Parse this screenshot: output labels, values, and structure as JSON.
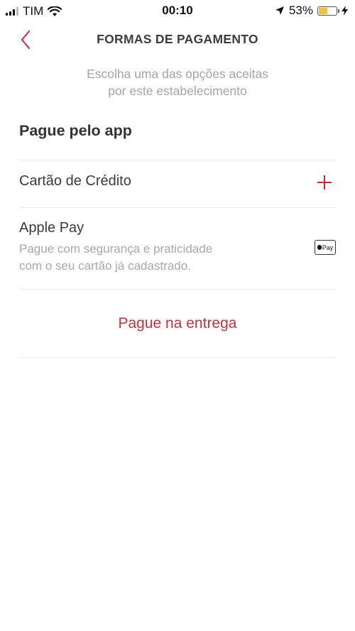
{
  "status_bar": {
    "carrier": "TIM",
    "time": "00:10",
    "battery_percent": "53%",
    "battery_level": 0.53,
    "icons": [
      "signal-icon",
      "wifi-icon",
      "location-arrow-icon",
      "battery-icon",
      "charging-bolt-icon"
    ]
  },
  "header": {
    "title": "FORMAS DE PAGAMENTO",
    "back_icon": "chevron-left-icon"
  },
  "subtitle": {
    "line1": "Escolha uma das opções aceitas",
    "line2": "por este estabelecimento"
  },
  "section": {
    "title": "Pague pelo app"
  },
  "options": {
    "credit_card": {
      "label": "Cartão de Crédito",
      "action_icon": "plus-icon"
    },
    "apple_pay": {
      "label": "Apple Pay",
      "desc_line1": "Pague com segurança e praticidade",
      "desc_line2": "com o seu cartão já cadastrado.",
      "badge_text": "Pay"
    }
  },
  "pay_on_delivery": {
    "label": "Pague na entrega"
  },
  "colors": {
    "accent": "#c8303c",
    "muted_text": "#a5a5a5",
    "divider": "#ececec"
  }
}
